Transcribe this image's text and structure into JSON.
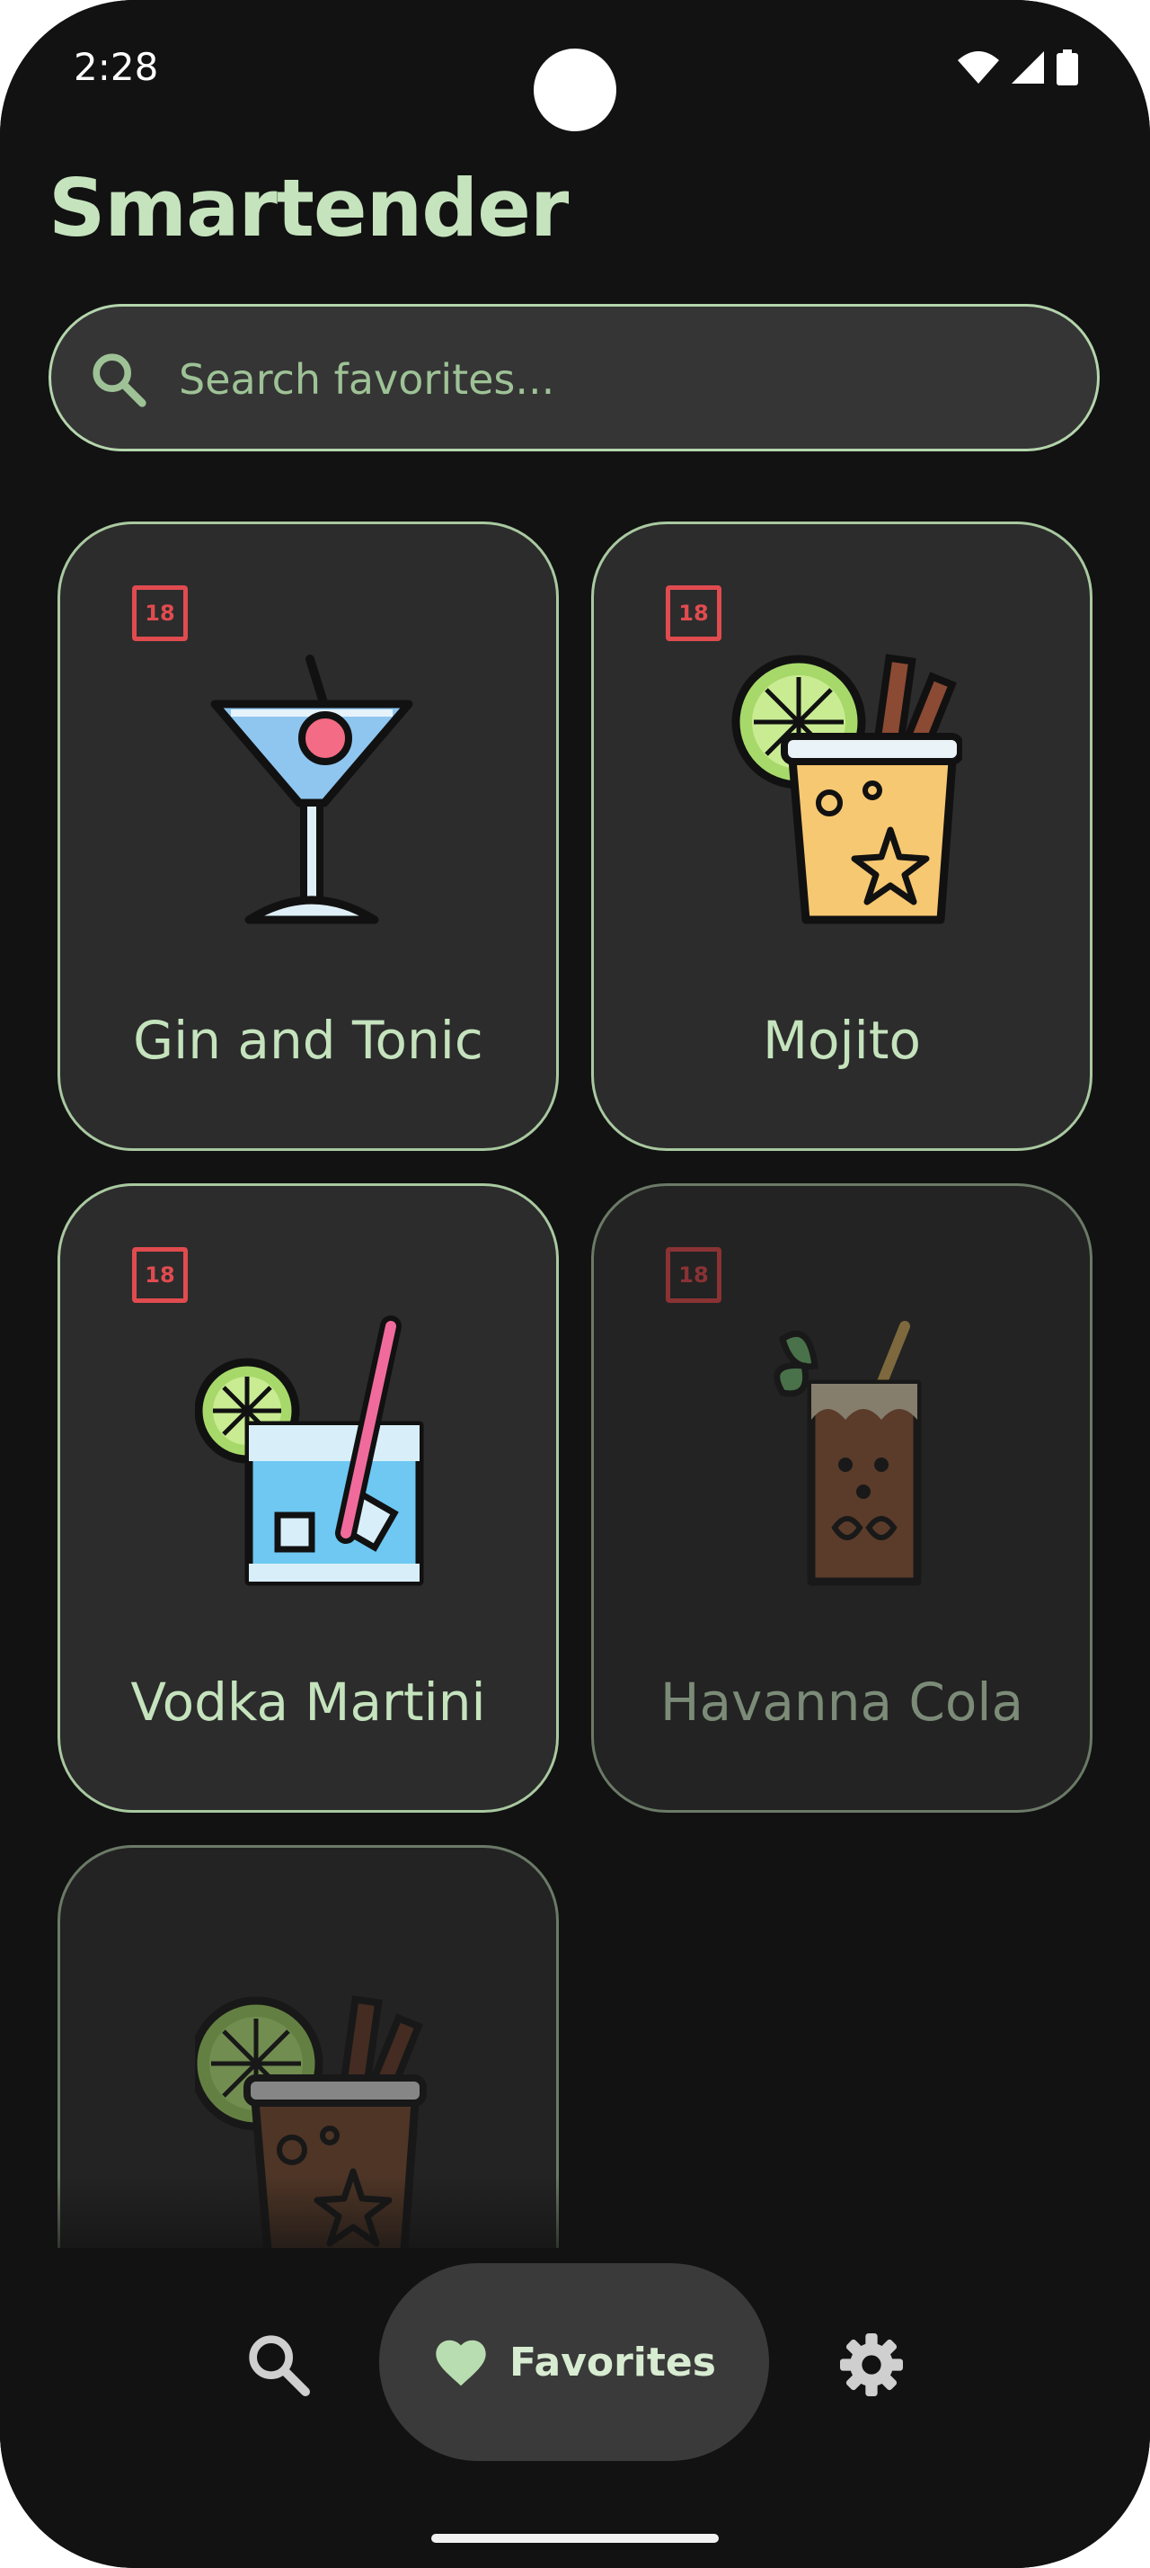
{
  "status_bar": {
    "time": "2:28",
    "icons": [
      "wifi-icon",
      "signal-icon",
      "battery-icon"
    ]
  },
  "app": {
    "title": "Smartender"
  },
  "search": {
    "placeholder": "Search favorites...",
    "value": ""
  },
  "badge_text": "18",
  "cards": [
    {
      "name": "Gin and Tonic",
      "icon": "martini-glass-icon",
      "dimmed": false,
      "age_badge": true
    },
    {
      "name": "Mojito",
      "icon": "cocktail-lime-cinnamon-icon",
      "dimmed": false,
      "age_badge": true
    },
    {
      "name": "Vodka Martini",
      "icon": "glass-ice-straw-icon",
      "dimmed": false,
      "age_badge": true
    },
    {
      "name": "Havanna Cola",
      "icon": "cola-glass-mint-icon",
      "dimmed": true,
      "age_badge": true
    },
    {
      "name": "",
      "icon": "dark-cocktail-lime-icon",
      "dimmed": true,
      "age_badge": false
    }
  ],
  "nav": {
    "items": [
      {
        "icon": "search-icon",
        "label": ""
      },
      {
        "icon": "heart-icon",
        "label": "Favorites",
        "selected": true
      },
      {
        "icon": "gear-icon",
        "label": ""
      }
    ]
  },
  "colors": {
    "accent": "#c5e3bd",
    "background": "#121212",
    "card": "#2c2c2c",
    "badge": "#e04b4f"
  }
}
